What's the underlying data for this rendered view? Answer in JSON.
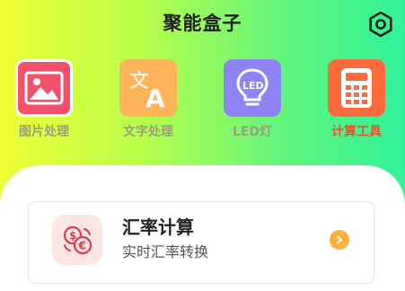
{
  "header": {
    "title": "聚能盒子",
    "settings_icon": "hexagon-settings-icon"
  },
  "tools": [
    {
      "label": "图片处理",
      "icon": "image-icon",
      "color": "#f25169",
      "active": false
    },
    {
      "label": "文字处理",
      "icon": "translate-icon",
      "color": "#ffb45a",
      "active": false
    },
    {
      "label": "LED灯",
      "icon": "led-bulb-icon",
      "color": "#8f83f6",
      "active": false
    },
    {
      "label": "计算工具",
      "icon": "calculator-icon",
      "color": "#ff6a3d",
      "active": true
    }
  ],
  "card": {
    "title": "汇率计算",
    "subtitle": "实时汇率转换",
    "icon": "currency-exchange-icon",
    "arrow_icon": "chevron-right-icon"
  },
  "colors": {
    "gradient_start": "#efff36",
    "gradient_end": "#2ff29a",
    "active_label": "#e8542c",
    "arrow": "#ffb13b"
  }
}
